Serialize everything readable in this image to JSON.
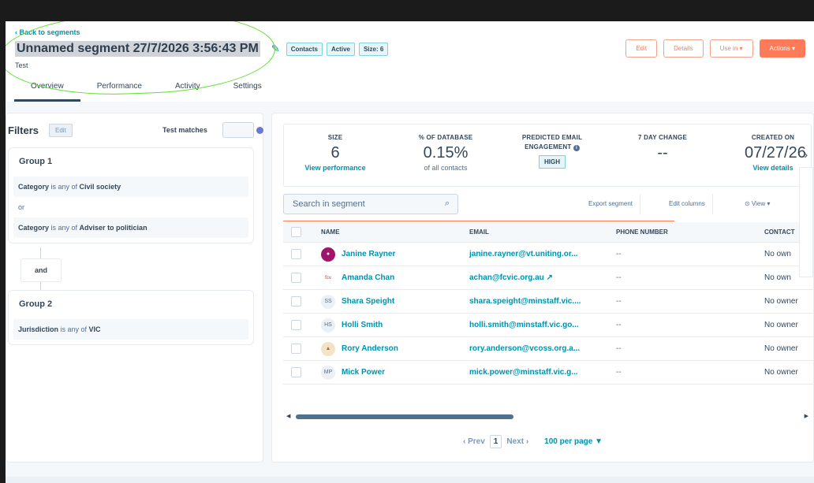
{
  "header": {
    "back_label": "‹ Back to segments",
    "title": "Unnamed segment 27/7/2026 3:56:43 PM",
    "subtitle": "Test",
    "badges": [
      "Contacts",
      "Active",
      "Size: 6"
    ],
    "buttons": {
      "edit": "Edit",
      "details": "Details",
      "use_in": "Use in ▾",
      "actions": "Actions ▾"
    },
    "tabs": [
      "Overview",
      "Performance",
      "Activity",
      "Settings"
    ]
  },
  "filters": {
    "title": "Filters",
    "edit": "Edit",
    "test_matches": "Test matches",
    "group1": {
      "title": "Group 1",
      "cond1": {
        "prop": "Category",
        "op": " is any of ",
        "value": "Civil society"
      },
      "or": "or",
      "cond2": {
        "prop": "Category",
        "op": " is any of ",
        "value": "Adviser to politician"
      }
    },
    "and": "and",
    "group2": {
      "title": "Group 2",
      "cond1": {
        "prop": "Jurisdiction",
        "op": " is any of ",
        "value": "VIC"
      }
    }
  },
  "stats": {
    "size": {
      "label": "SIZE",
      "value": "6",
      "link": "View performance"
    },
    "pct": {
      "label": "% OF DATABASE",
      "value": "0.15%",
      "sub": "of all contacts"
    },
    "engagement": {
      "label1": "PREDICTED EMAIL",
      "label2": "ENGAGEMENT",
      "badge": "HIGH"
    },
    "change": {
      "label": "7 DAY CHANGE",
      "value": "--"
    },
    "created": {
      "label": "CREATED ON",
      "value": "07/27/26",
      "link": "View details"
    }
  },
  "toolbar": {
    "search_placeholder": "Search in segment",
    "export": "Export segment",
    "edit_columns": "Edit columns",
    "view": "⊙ View ▾"
  },
  "table": {
    "headers": {
      "name": "NAME",
      "email": "EMAIL",
      "phone": "PHONE NUMBER",
      "owner": "CONTACT"
    },
    "rows": [
      {
        "initials": "",
        "name": "Janine Rayner",
        "email": "janine.rayner@vt.uniting.or...",
        "phone": "--",
        "owner": "No own"
      },
      {
        "initials": "",
        "name": "Amanda Chan",
        "email": "achan@fcvic.org.au ↗",
        "phone": "--",
        "owner": "No own"
      },
      {
        "initials": "SS",
        "name": "Shara Speight",
        "email": "shara.speight@minstaff.vic....",
        "phone": "--",
        "owner": "No owner"
      },
      {
        "initials": "HS",
        "name": "Holli Smith",
        "email": "holli.smith@minstaff.vic.go...",
        "phone": "--",
        "owner": "No owner"
      },
      {
        "initials": "",
        "name": "Rory Anderson",
        "email": "rory.anderson@vcoss.org.a...",
        "phone": "--",
        "owner": "No owner"
      },
      {
        "initials": "MP",
        "name": "Mick Power",
        "email": "mick.power@minstaff.vic.g...",
        "phone": "--",
        "owner": "No owner"
      }
    ]
  },
  "pager": {
    "prev": "‹ Prev",
    "page": "1",
    "next": "Next ›",
    "per_page": "100 per page ▼"
  }
}
